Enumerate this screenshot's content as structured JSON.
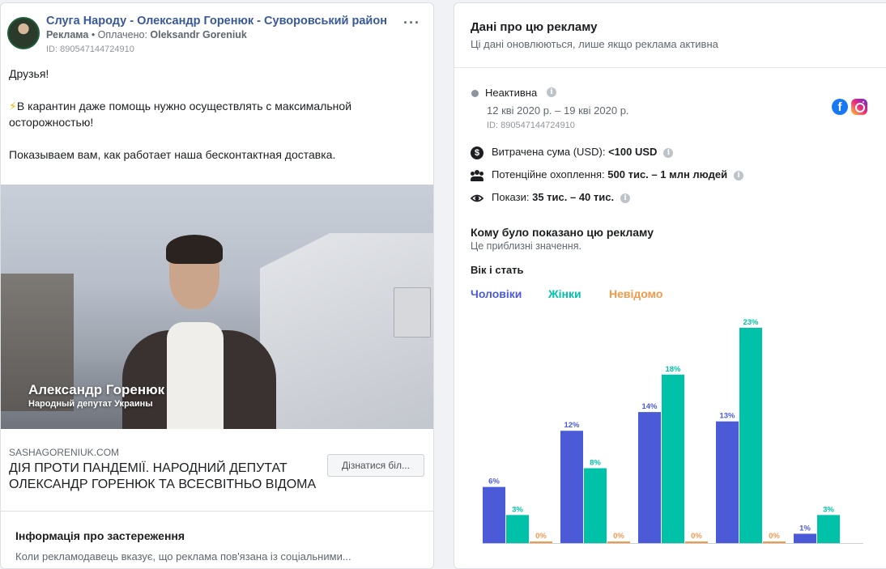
{
  "post": {
    "page_name": "Слуга Народу - Олександр Горенюк - Суворовський район",
    "ad_label": "Реклама",
    "paid_prefix": "• Оплачено:",
    "payer": "Oleksandr Goreniuk",
    "ad_id": "ID: 890547144724910",
    "more_label": "···",
    "text_lines": [
      "Друзья!",
      "В карантин даже помощь нужно осуществлять с максимальной осторожностью!",
      "Показываем вам, как работает наша бесконтактная доставка."
    ],
    "bolt": "⚡",
    "video": {
      "caption_name": "Александр Горенюк",
      "caption_title": "Народный депутат Украины"
    },
    "link_domain": "SASHAGORENIUK.COM",
    "link_title": "ДІЯ ПРОТИ ПАНДЕМІЇ. НАРОДНИЙ ДЕПУТАТ ОЛЕКСАНДР ГОРЕНЮК ТА ВСЕСВІТНЬО ВІДОМА",
    "cta_label": "Дізнатися біл...",
    "warning_heading": "Інформація про застереження",
    "warning_text": "Коли рекламодавець вказує, що реклама пов'язана із соціальними..."
  },
  "details": {
    "title": "Дані про цю рекламу",
    "subtitle": "Ці дані оновлюються, лише якщо реклама активна",
    "status": "Неактивна",
    "dates": "12 кві 2020 р. – 19 кві 2020 р.",
    "ad_id": "ID: 890547144724910",
    "platforms": [
      "facebook-icon",
      "instagram-icon"
    ],
    "spend_label": "Витрачена сума (USD):",
    "spend_value": "<100 USD",
    "reach_label": "Потенційне охоплення:",
    "reach_value": "500 тис. – 1 млн людей",
    "impressions_label": "Покази:",
    "impressions_value": "35 тис. – 40 тис.",
    "info_glyph": "i",
    "dollar_glyph": "$"
  },
  "audience": {
    "title": "Кому було показано цю рекламу",
    "subtitle": "Це приблизні значення.",
    "section_label": "Вік і стать",
    "tabs": {
      "men": "Чоловіки",
      "women": "Жінки",
      "unknown": "Невідомо"
    },
    "colors": {
      "men": "#4b5bd8",
      "women": "#00c2a8",
      "unknown": "#f2994a"
    }
  },
  "chart_data": {
    "type": "bar",
    "series": [
      {
        "name": "Чоловіки",
        "values": [
          6,
          12,
          14,
          13,
          1
        ]
      },
      {
        "name": "Жінки",
        "values": [
          3,
          8,
          18,
          23,
          3
        ]
      },
      {
        "name": "Невідомо",
        "values": [
          0,
          0,
          0,
          0,
          null
        ]
      }
    ],
    "labels": [
      [
        "6%",
        "12%",
        "14%",
        "13%",
        "1%"
      ],
      [
        "3%",
        "8%",
        "18%",
        "23%",
        "3%"
      ],
      [
        "0%",
        "0%",
        "0%",
        "0%",
        ""
      ]
    ],
    "ylim": [
      0,
      23
    ]
  }
}
